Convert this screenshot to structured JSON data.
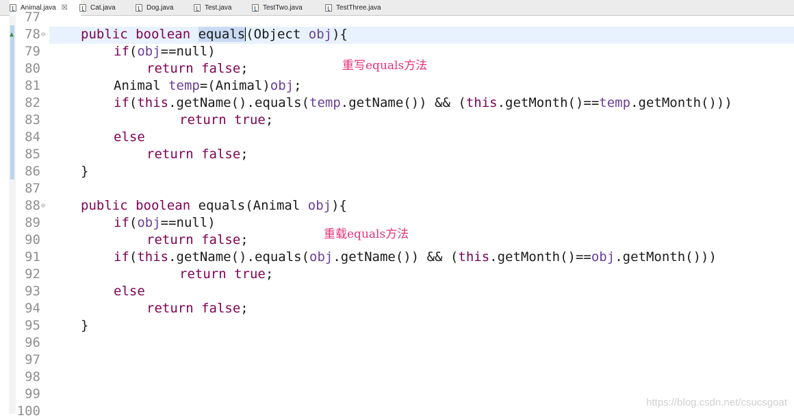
{
  "tabs": [
    {
      "label": "Animal.java",
      "close": "☒",
      "active": true
    },
    {
      "label": "Cat.java"
    },
    {
      "label": "Dog.java"
    },
    {
      "label": "Test.java"
    },
    {
      "label": "TestTwo.java"
    },
    {
      "label": "TestThree.java"
    }
  ],
  "editor": {
    "line_numbers": [
      "77",
      "78",
      "79",
      "80",
      "81",
      "82",
      "83",
      "84",
      "85",
      "86",
      "87",
      "88",
      "89",
      "90",
      "91",
      "92",
      "93",
      "94",
      "95",
      "96",
      "97",
      "98",
      "99",
      "100"
    ],
    "current_line": "78",
    "fold_markers": [
      "78",
      "88"
    ],
    "annotations": {
      "override": "重写equals方法",
      "overload": "重载equals方法"
    },
    "code": {
      "l78": {
        "kw": "public boolean ",
        "sel": "equals",
        "rest": "(Object ",
        "var": "obj",
        "end": "){"
      },
      "l79": {
        "kw": "if",
        "a": "(",
        "var": "obj",
        "b": "==null)"
      },
      "l80": {
        "kw": "return false",
        "b": ";"
      },
      "l81": {
        "a": "Animal ",
        "var": "temp",
        "b": "=(Animal)",
        "var2": "obj",
        "c": ";"
      },
      "l82": {
        "kw": "if",
        "a": "(",
        "kw2": "this",
        "b": ".getName().equals(",
        "var": "temp",
        "c": ".getName()) && (",
        "kw3": "this",
        "d": ".getMonth()==",
        "var2": "temp",
        "e": ".getMonth()))"
      },
      "l83": {
        "kw": "return true",
        "b": ";"
      },
      "l84": {
        "kw": "else"
      },
      "l85": {
        "kw": "return false",
        "b": ";"
      },
      "l86": {
        "a": "}"
      },
      "l88": {
        "kw": "public boolean ",
        "a": "equals(Animal ",
        "var": "obj",
        "end": "){"
      },
      "l89": {
        "kw": "if",
        "a": "(",
        "var": "obj",
        "b": "==null)"
      },
      "l90": {
        "kw": "return false",
        "b": ";"
      },
      "l91": {
        "kw": "if",
        "a": "(",
        "kw2": "this",
        "b": ".getName().equals(",
        "var": "obj",
        "c": ".getName()) && (",
        "kw3": "this",
        "d": ".getMonth()==",
        "var2": "obj",
        "e": ".getMonth()))"
      },
      "l92": {
        "kw": "return true",
        "b": ";"
      },
      "l93": {
        "kw": "else"
      },
      "l94": {
        "kw": "return false",
        "b": ";"
      },
      "l95": {
        "a": "}"
      }
    }
  },
  "watermark": "https://blog.csdn.net/csucsgoat",
  "colors": {
    "keyword": "#7f0055",
    "variable": "#6a3e9a",
    "annotation": "#e6317a",
    "line_highlight": "#e8f2fe"
  }
}
